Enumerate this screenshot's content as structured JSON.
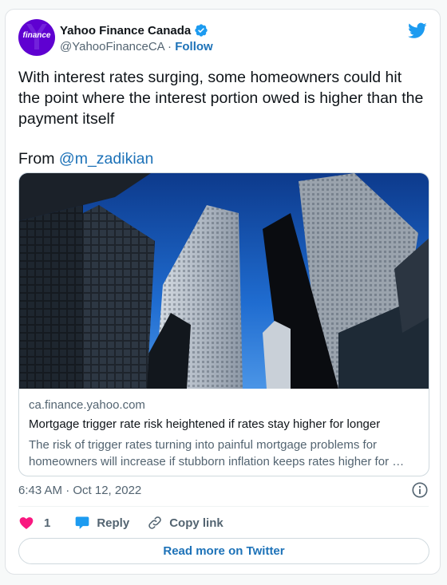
{
  "author": {
    "display_name": "Yahoo Finance Canada",
    "handle": "@YahooFinanceCA",
    "separator": "·",
    "follow_label": "Follow",
    "avatar_text": "finance",
    "avatar_color": "#5f01d1"
  },
  "tweet": {
    "text": "With interest rates surging, some homeowners could hit the point where the interest portion owed is higher than the payment itself",
    "from_label": "From",
    "mention": "@m_zadikian"
  },
  "link_card": {
    "domain": "ca.finance.yahoo.com",
    "title": "Mortgage trigger rate risk heightened if rates stay higher for longer",
    "description_line1": "The risk of trigger rates turning into painful mortgage problems for",
    "description_line2": "homeowners will increase if stubborn inflation keeps rates higher for …"
  },
  "meta": {
    "timestamp": "6:43 AM · Oct 12, 2022"
  },
  "actions": {
    "like_count": "1",
    "reply_label": "Reply",
    "copy_label": "Copy link"
  },
  "read_more_label": "Read more on Twitter",
  "icons": {
    "verified": "verified-badge-icon",
    "bird": "twitter-bird-icon",
    "info": "info-icon",
    "like": "heart-icon",
    "reply": "speech-bubble-icon",
    "copy": "link-icon"
  },
  "colors": {
    "accent": "#1d72b8",
    "heart": "#f91880",
    "twitter_blue": "#1d9bf0"
  }
}
